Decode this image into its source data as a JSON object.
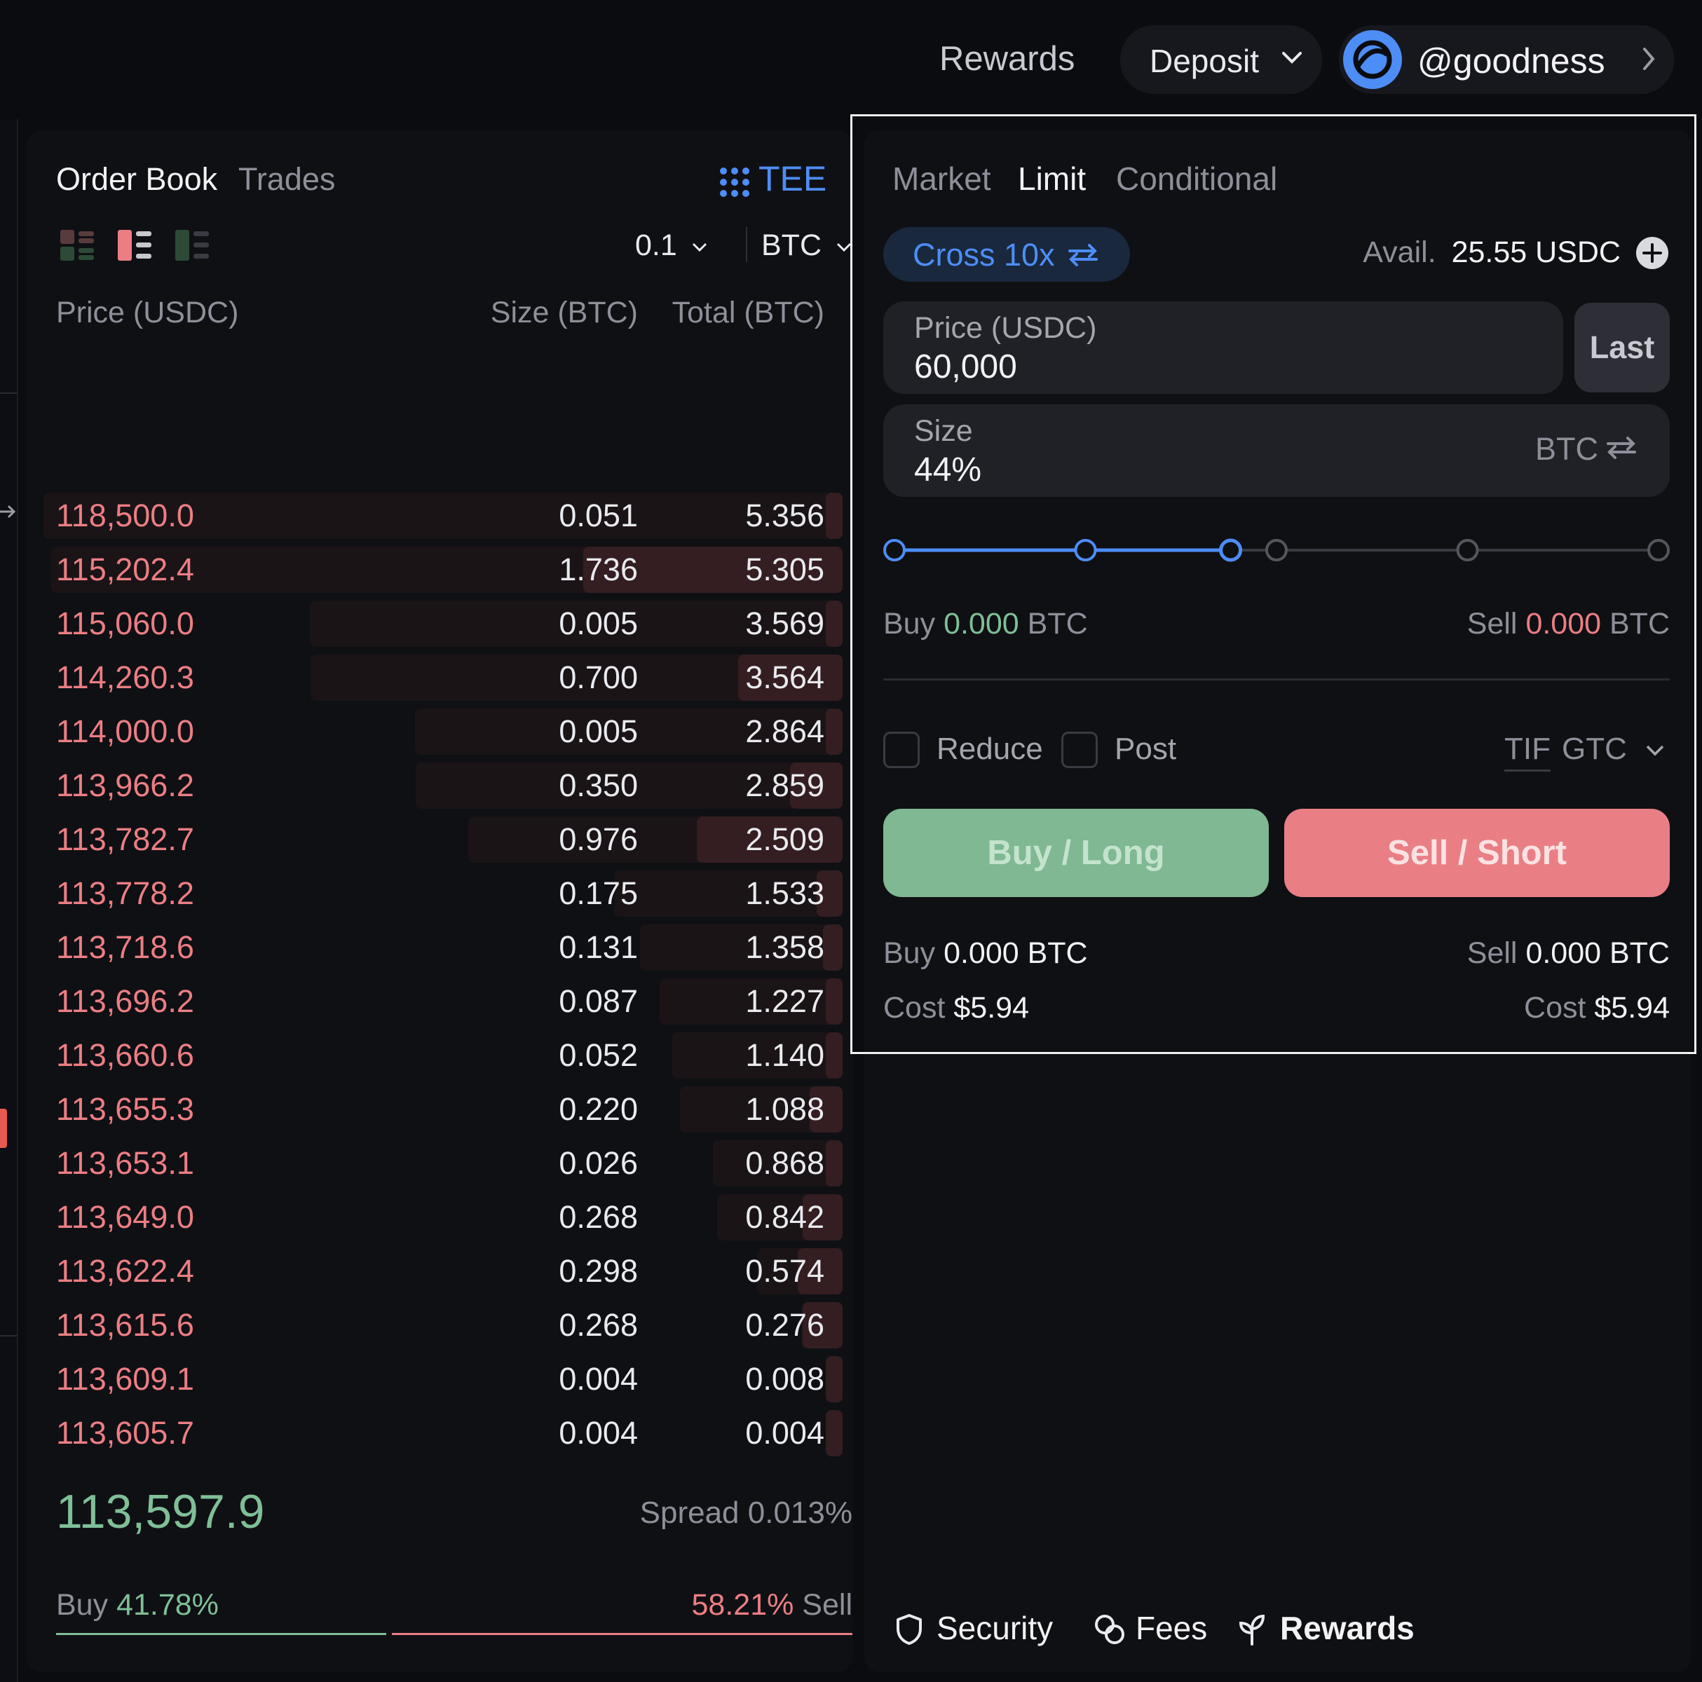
{
  "header": {
    "rewards_label": "Rewards",
    "deposit_label": "Deposit",
    "username": "@goodness"
  },
  "orderbook": {
    "tabs": [
      "Order Book",
      "Trades"
    ],
    "tee_label": "TEE",
    "tick_size": "0.1",
    "unit": "BTC",
    "columns": [
      "Price (USDC)",
      "Size (BTC)",
      "Total (BTC)"
    ],
    "asks": [
      {
        "price": "118,500.0",
        "size": "0.051",
        "total": "5.356"
      },
      {
        "price": "115,202.4",
        "size": "1.736",
        "total": "5.305"
      },
      {
        "price": "115,060.0",
        "size": "0.005",
        "total": "3.569"
      },
      {
        "price": "114,260.3",
        "size": "0.700",
        "total": "3.564"
      },
      {
        "price": "114,000.0",
        "size": "0.005",
        "total": "2.864"
      },
      {
        "price": "113,966.2",
        "size": "0.350",
        "total": "2.859"
      },
      {
        "price": "113,782.7",
        "size": "0.976",
        "total": "2.509"
      },
      {
        "price": "113,778.2",
        "size": "0.175",
        "total": "1.533"
      },
      {
        "price": "113,718.6",
        "size": "0.131",
        "total": "1.358"
      },
      {
        "price": "113,696.2",
        "size": "0.087",
        "total": "1.227"
      },
      {
        "price": "113,660.6",
        "size": "0.052",
        "total": "1.140"
      },
      {
        "price": "113,655.3",
        "size": "0.220",
        "total": "1.088"
      },
      {
        "price": "113,653.1",
        "size": "0.026",
        "total": "0.868"
      },
      {
        "price": "113,649.0",
        "size": "0.268",
        "total": "0.842"
      },
      {
        "price": "113,622.4",
        "size": "0.298",
        "total": "0.574"
      },
      {
        "price": "113,615.6",
        "size": "0.268",
        "total": "0.276"
      },
      {
        "price": "113,609.1",
        "size": "0.004",
        "total": "0.008"
      },
      {
        "price": "113,605.7",
        "size": "0.004",
        "total": "0.004"
      }
    ],
    "mid_price": "113,597.9",
    "spread_label": "Spread",
    "spread_value": "0.013%",
    "buy_label": "Buy",
    "buy_pct": "41.78%",
    "sell_label": "Sell",
    "sell_pct": "58.21%",
    "buy_ratio": 0.4178
  },
  "order_form": {
    "tabs": [
      "Market",
      "Limit",
      "Conditional"
    ],
    "active_tab": "Limit",
    "margin_mode": "Cross 10x",
    "avail_label": "Avail.",
    "avail_value": "25.55 USDC",
    "price_label": "Price (USDC)",
    "price_value": "60,000",
    "last_button": "Last",
    "size_label": "Size",
    "size_value": "44%",
    "size_unit": "BTC",
    "slider_percent": 44,
    "buy_label": "Buy",
    "buy_amount": "0.000",
    "sell_label": "Sell",
    "sell_amount": "0.000",
    "amount_unit": "BTC",
    "reduce_label": "Reduce",
    "post_label": "Post",
    "tif_label": "TIF",
    "tif_value": "GTC",
    "buy_button": "Buy / Long",
    "sell_button": "Sell / Short",
    "summary": {
      "buy_label": "Buy",
      "buy_value": "0.000 BTC",
      "sell_label": "Sell",
      "sell_value": "0.000 BTC",
      "cost_label": "Cost",
      "buy_cost": "$5.94",
      "sell_cost": "$5.94"
    }
  },
  "footer": {
    "links": [
      "Security",
      "Fees",
      "Rewards"
    ]
  },
  "colors": {
    "accent_blue": "#4d8df6",
    "ask_red": "#ec7e83",
    "bid_green": "#7fbf97",
    "buy_button": "#7fb893",
    "sell_button": "#e97f85"
  }
}
